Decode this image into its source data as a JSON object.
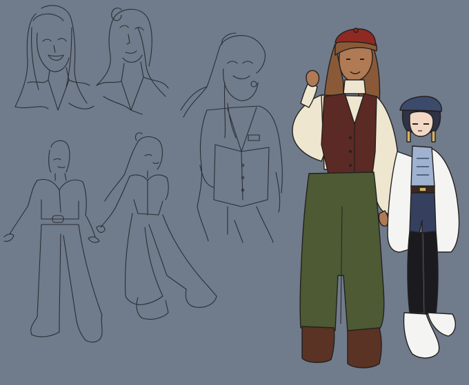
{
  "artwork": {
    "background": "#707b8b",
    "line_color": "#2a2e34",
    "palette": {
      "beret_red": "#8f2a22",
      "hair_brown": "#8a5a38",
      "skin_tan": "#b07a55",
      "skin_light": "#f2d7c4",
      "sweater_cream": "#efe6cf",
      "vest_maroon": "#5b2a24",
      "pants_olive": "#4d5a34",
      "boots_brown": "#5a3324",
      "coat_white": "#f4f4f2",
      "cap_navy": "#3c4a6c",
      "shirt_lightblue": "#9fb2cf",
      "shorts_navy": "#34405e",
      "tights_black": "#1b1b1f"
    }
  }
}
